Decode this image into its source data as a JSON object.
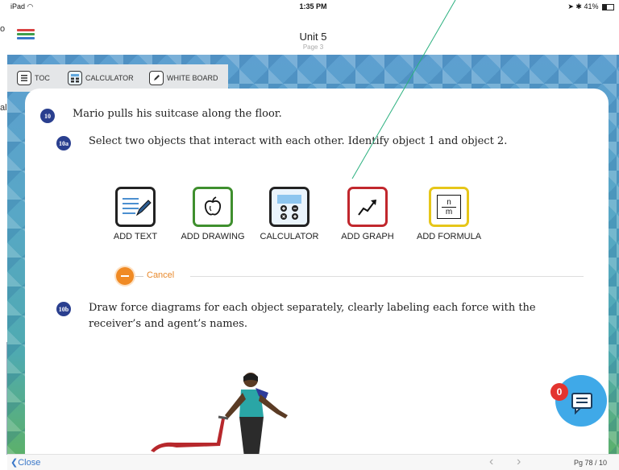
{
  "desktop": {
    "fragments": [
      "o",
      "al"
    ]
  },
  "status": {
    "device": "iPad",
    "time": "1:35 PM",
    "battery": "41%"
  },
  "nav": {
    "title": "Unit 5",
    "subtitle": "Page 3"
  },
  "toolbar": {
    "toc": "TOC",
    "calculator": "CALCULATOR",
    "whiteboard": "WHITE BOARD"
  },
  "question": {
    "number": "10",
    "text": "Mario pulls his suitcase along the floor.",
    "parts": [
      {
        "label": "10a",
        "text": "Select two objects that interact with each other. Identify object 1 and object 2."
      },
      {
        "label": "10b",
        "text_line1": "Draw force diagrams for each object separately, clearly labeling each force with the",
        "text_line2": "receiver’s and agent’s names."
      }
    ]
  },
  "options": [
    {
      "label": "ADD TEXT",
      "icon": "text-pencil-icon",
      "color": "#222222"
    },
    {
      "label": "ADD DRAWING",
      "icon": "apple-drawing-icon",
      "color": "#3f8f2e"
    },
    {
      "label": "CALCULATOR",
      "icon": "calculator-icon",
      "color": "#222222"
    },
    {
      "label": "ADD GRAPH",
      "icon": "graph-arrow-icon",
      "color": "#c1272d"
    },
    {
      "label": "ADD FORMULA",
      "icon": "fraction-formula-icon",
      "color": "#e6c619",
      "formula_num": "n",
      "formula_den": "m"
    }
  ],
  "cancel": {
    "label": "Cancel"
  },
  "chat": {
    "badge_count": "0"
  },
  "footer": {
    "close": "Close",
    "page_indicator": "Pg 78 / 10"
  },
  "colors": {
    "accent": "#3a78c9",
    "qnum_bg": "#2a3f8f",
    "cancel_orange": "#f08a24",
    "chat_blue": "#3fa9e8"
  }
}
